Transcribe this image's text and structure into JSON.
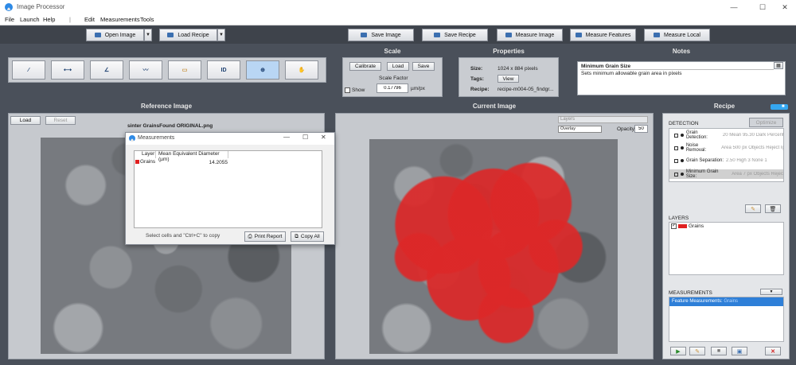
{
  "window": {
    "title": "Image Processor",
    "minimize": "—",
    "maximize": "☐",
    "close": "✕"
  },
  "menu": [
    "File",
    "Launch",
    "Help",
    "|",
    "Edit",
    "Measurements",
    "Tools"
  ],
  "toolbar": {
    "open_image": "Open Image",
    "load_recipe": "Load Recipe",
    "save_image": "Save Image",
    "save_recipe": "Save Recipe",
    "measure_image": "Measure Image",
    "measure_features": "Measure Features",
    "measure_local": "Measure Local"
  },
  "sections": {
    "scale": "Scale",
    "properties": "Properties",
    "notes": "Notes",
    "reference": "Reference Image",
    "current": "Current Image",
    "recipe": "Recipe"
  },
  "tools": [
    "picker-icon",
    "line-icon",
    "angle-icon",
    "trace-icon",
    "ruler-icon",
    "ID",
    "zoom-icon",
    "hand-icon"
  ],
  "scale": {
    "calibrate": "Calibrate",
    "load": "Load",
    "save": "Save",
    "factor_label": "Scale Factor",
    "show": "Show",
    "factor_value": "0.17796",
    "unit": "µm/px"
  },
  "properties": {
    "size_label": "Size:",
    "size_value": "1024 x 884 pixels",
    "tags_label": "Tags:",
    "tags_button": "View",
    "recipe_label": "Recipe:",
    "recipe_value": "recipe-m004-05_findgr..."
  },
  "notes": {
    "title": "Minimum Grain Size",
    "text": "Sets minimum allowable grain area in pixels"
  },
  "reference": {
    "load": "Load",
    "reset": "Reset",
    "filename": "sinter GrainsFound ORIGINAL.png"
  },
  "current": {
    "layers": "Layers",
    "mode": "Overlay",
    "opacity_label": "Opacity:",
    "opacity_value": "50"
  },
  "measurements_dialog": {
    "title": "Measurements",
    "col_layer": "Layer",
    "col_value": "Mean Equivalent Diameter (µm)",
    "rows": [
      {
        "layer": "Grains",
        "value": "14.2055",
        "color": "#e02020"
      }
    ],
    "hint": "Select cells and \"Ctrl+C\" to copy",
    "print": "Print Report",
    "copy": "Copy All"
  },
  "recipe": {
    "detection_label": "DETECTION",
    "optimize": "Optimize",
    "steps": [
      {
        "name": "Grain Detection:",
        "detail": "20 Mean 95.30 Dark Percent"
      },
      {
        "name": "Noise Removal:",
        "detail": "Area 500 px Objects Reject Ig"
      },
      {
        "name": "Grain Separation:",
        "detail": "2.50 High 3 None 1"
      },
      {
        "name": "Minimum Grain Size:",
        "detail": "Area 7 px Objects Reject"
      }
    ],
    "layers_label": "LAYERS",
    "layers": [
      {
        "name": "Grains",
        "color": "#e02020"
      }
    ],
    "measurements_label": "MEASUREMENTS",
    "measurement_item": "Feature Measurements:",
    "measurement_item_detail": "Grains"
  }
}
